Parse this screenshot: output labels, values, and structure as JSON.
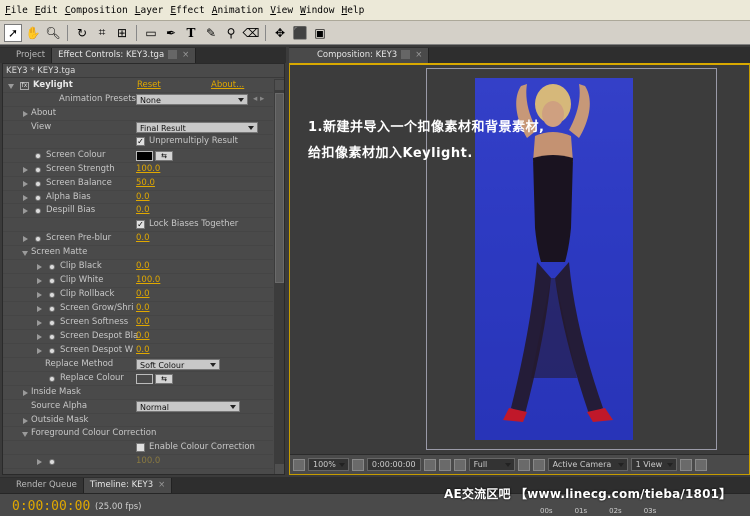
{
  "menu": [
    {
      "label": "File",
      "u": "F",
      "rest": "ile"
    },
    {
      "label": "Edit",
      "u": "E",
      "rest": "dit"
    },
    {
      "label": "Composition",
      "u": "C",
      "rest": "omposition"
    },
    {
      "label": "Layer",
      "u": "L",
      "rest": "ayer"
    },
    {
      "label": "Effect",
      "u": "E",
      "rest": "ffect"
    },
    {
      "label": "Animation",
      "u": "A",
      "rest": "nimation"
    },
    {
      "label": "View",
      "u": "V",
      "rest": "iew"
    },
    {
      "label": "Window",
      "u": "W",
      "rest": "indow"
    },
    {
      "label": "Help",
      "u": "H",
      "rest": "elp"
    }
  ],
  "left_tabs": {
    "project": "Project",
    "effect_controls": "Effect Controls: KEY3.tga"
  },
  "layer_path": "KEY3 * KEY3.tga",
  "effect": {
    "name": "Keylight",
    "reset": "Reset",
    "about_link": "About...",
    "presets_label": "Animation Presets:",
    "presets_value": "None",
    "about": "About",
    "view_label": "View",
    "view_value": "Final Result",
    "unpremultiply": "Unpremultiply Result",
    "screen_colour": "Screen Colour",
    "screen_strength": "Screen Strength",
    "screen_strength_val": "100.0",
    "screen_balance": "Screen Balance",
    "screen_balance_val": "50.0",
    "alpha_bias": "Alpha Bias",
    "alpha_bias_val": "0.0",
    "despill_bias": "Despill Bias",
    "despill_bias_val": "0.0",
    "lock_biases": "Lock Biases Together",
    "screen_preblur": "Screen Pre-blur",
    "screen_preblur_val": "0.0",
    "screen_matte": "Screen Matte",
    "clip_black": "Clip Black",
    "clip_black_val": "0.0",
    "clip_white": "Clip White",
    "clip_white_val": "100.0",
    "clip_rollback": "Clip Rollback",
    "clip_rollback_val": "0.0",
    "screen_grow": "Screen Grow/Shri",
    "screen_grow_val": "0.0",
    "screen_softness": "Screen Softness",
    "screen_softness_val": "0.0",
    "screen_despot_black": "Screen Despot Bla",
    "screen_despot_black_val": "0.0",
    "screen_despot_white": "Screen Despot W",
    "screen_despot_white_val": "0.0",
    "replace_method": "Replace Method",
    "replace_method_val": "Soft Colour",
    "replace_colour": "Replace Colour",
    "inside_mask": "Inside Mask",
    "source_alpha": "Source Alpha",
    "source_alpha_val": "Normal",
    "outside_mask": "Outside Mask",
    "fg_colour_correction": "Foreground Colour Correction",
    "enable_cc": "Enable Colour Correction",
    "last_val": "100.0"
  },
  "comp_tab": "Composition: KEY3",
  "comp_annotation": {
    "line1": "1.新建并导入一个扣像素材和背景素材,",
    "line2": "给扣像素材加入Keylight."
  },
  "comp_footer": {
    "zoom": "100%",
    "time": "0:00:00:00",
    "resolution": "Full",
    "camera": "Active Camera",
    "views": "1 View"
  },
  "bottom_tabs": {
    "render_queue": "Render Queue",
    "timeline": "Timeline: KEY3"
  },
  "timecode": "0:00:00:00",
  "fps": "(25.00 fps)",
  "watermark": "AE交流区吧 【www.linecg.com/tieba/1801】",
  "ruler": [
    "00s",
    "01s",
    "02s",
    "03s"
  ],
  "colors": {
    "accent": "#e0a800",
    "screen_blue": "#2f3cc0",
    "panel": "#4a4a4a"
  }
}
